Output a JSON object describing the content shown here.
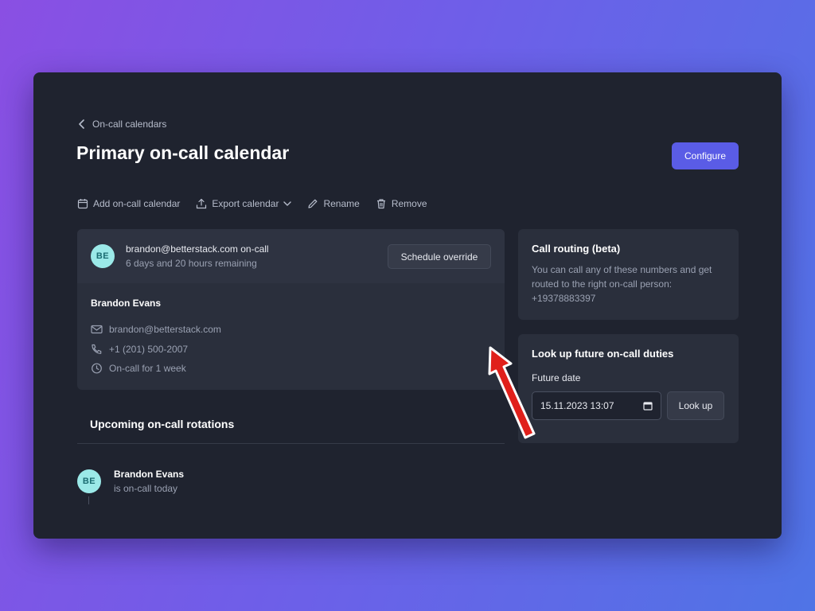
{
  "breadcrumb": {
    "back_label": "On-call calendars"
  },
  "page": {
    "title": "Primary on-call calendar",
    "configure_label": "Configure"
  },
  "toolbar": {
    "add_label": "Add on-call calendar",
    "export_label": "Export calendar",
    "rename_label": "Rename",
    "remove_label": "Remove"
  },
  "current_oncall": {
    "initials": "BE",
    "title": "brandon@betterstack.com on-call",
    "remaining": "6 days and 20 hours remaining",
    "override_label": "Schedule override",
    "name": "Brandon Evans",
    "email": "brandon@betterstack.com",
    "phone": "+1 (201) 500-2007",
    "duration": "On-call for 1 week"
  },
  "upcoming": {
    "title": "Upcoming on-call rotations",
    "items": [
      {
        "initials": "BE",
        "name": "Brandon Evans",
        "status": "is on-call today"
      }
    ]
  },
  "call_routing": {
    "title": "Call routing (beta)",
    "description": "You can call any of these numbers and get routed to the right on-call person:",
    "number": "+19378883397"
  },
  "lookup": {
    "title": "Look up future on-call duties",
    "field_label": "Future date",
    "date_value": "15.11.2023 13:07",
    "button_label": "Look up"
  },
  "colors": {
    "accent": "#5a5ce6",
    "avatar_bg": "#9be9e8",
    "annotation_arrow": "#e0201b"
  }
}
